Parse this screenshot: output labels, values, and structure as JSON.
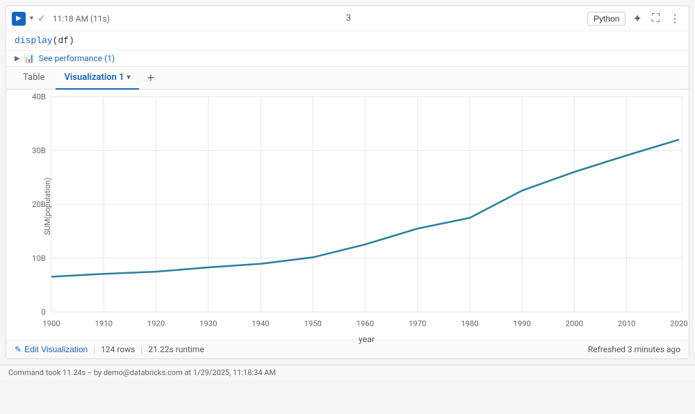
{
  "cell": {
    "run_icon": "▶",
    "timestamp": "11:18 AM (11s)",
    "cell_number": "3",
    "python_label": "Python",
    "code_line": "display(df)",
    "performance_label": "See performance (1)",
    "tabs": [
      {
        "id": "table",
        "label": "Table",
        "active": false
      },
      {
        "id": "viz1",
        "label": "Visualization 1",
        "active": true
      }
    ],
    "add_tab_label": "+",
    "chart": {
      "y_axis_label": "SUM(population)",
      "x_axis_label": "year",
      "y_ticks": [
        "0",
        "10B",
        "20B",
        "30B",
        "40B"
      ],
      "x_ticks": [
        "1900",
        "1910",
        "1920",
        "1930",
        "1940",
        "1950",
        "1960",
        "1970",
        "1980",
        "1990",
        "2000",
        "2010",
        "2020"
      ],
      "data_points": [
        {
          "year": 1900,
          "val": 6.5
        },
        {
          "year": 1910,
          "val": 7.0
        },
        {
          "year": 1920,
          "val": 7.5
        },
        {
          "year": 1930,
          "val": 8.2
        },
        {
          "year": 1940,
          "val": 9.0
        },
        {
          "year": 1950,
          "val": 10.2
        },
        {
          "year": 1960,
          "val": 12.5
        },
        {
          "year": 1970,
          "val": 15.5
        },
        {
          "year": 1980,
          "val": 17.5
        },
        {
          "year": 1990,
          "val": 22.5
        },
        {
          "year": 2000,
          "val": 26.0
        },
        {
          "year": 2010,
          "val": 29.0
        },
        {
          "year": 2020,
          "val": 32.0
        }
      ]
    },
    "footer": {
      "edit_viz_label": "Edit Visualization",
      "rows_info": "124 rows",
      "runtime_info": "21.22s runtime",
      "refreshed": "Refreshed 3 minutes ago"
    },
    "command_bar": "Command took 11.24s -- by demo@databricks.com at 1/29/2025, 11:18:34 AM"
  }
}
